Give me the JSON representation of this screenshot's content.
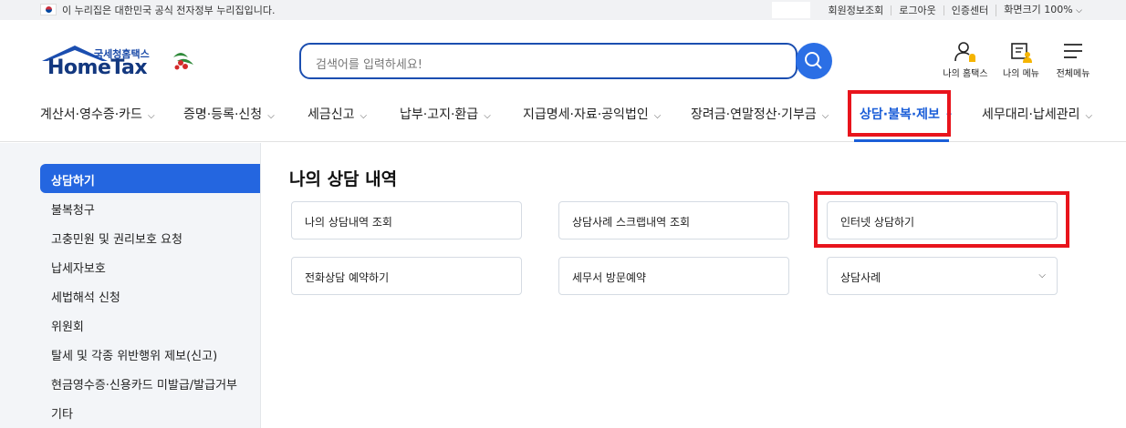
{
  "gov_bar": {
    "notice": "이 누리집은 대한민국 공식 전자정부 누리집입니다.",
    "links": [
      "회원정보조회",
      "로그아웃",
      "인증센터",
      "화면크기 100%"
    ]
  },
  "logo": {
    "sub": "국세청홈택스",
    "main": "HomeTax"
  },
  "search": {
    "placeholder": "검색어를 입력하세요!"
  },
  "header_icons": {
    "my_hometax": "나의 홈택스",
    "my_menu": "나의 메뉴",
    "all_menu": "전체메뉴"
  },
  "gnb": [
    "계산서·영수증·카드",
    "증명·등록·신청",
    "세금신고",
    "납부·고지·환급",
    "지급명세·자료·공익법인",
    "장려금·연말정산·기부금",
    "상담·불복·제보",
    "세무대리·납세관리"
  ],
  "lnb": {
    "active": "상담하기",
    "items": [
      "불복청구",
      "고충민원 및 권리보호 요청",
      "납세자보호",
      "세법해석 신청",
      "위원회",
      "탈세 및 각종 위반행위 제보(신고)",
      "현금영수증·신용카드 미발급/발급거부",
      "기타"
    ]
  },
  "content": {
    "title": "나의 상담 내역",
    "cards": [
      "나의 상담내역 조회",
      "상담사례 스크랩내역 조회",
      "인터넷 상담하기",
      "전화상담 예약하기",
      "세무서 방문예약",
      "상담사례"
    ]
  },
  "colors": {
    "accent": "#1b5ed8",
    "highlight": "#e8141c",
    "active_menu_bg": "#2466e0"
  }
}
